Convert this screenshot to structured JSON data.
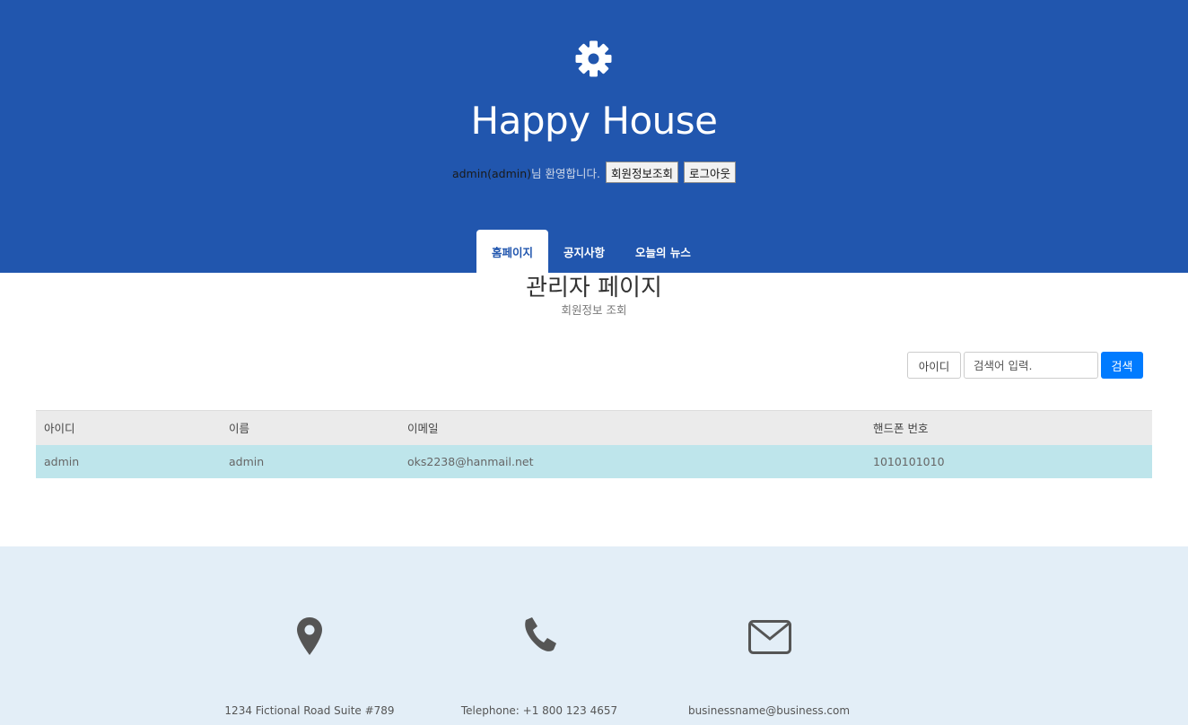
{
  "header": {
    "site_title": "Happy House",
    "welcome_user": "admin(admin)",
    "welcome_suffix": "님 환영합니다.",
    "member_info_button": "회원정보조회",
    "logout_button": "로그아웃",
    "icon": "gear-icon"
  },
  "nav": {
    "tabs": [
      {
        "label": "홈페이지",
        "active": true
      },
      {
        "label": "공지사항",
        "active": false
      },
      {
        "label": "오늘의 뉴스",
        "active": false
      }
    ]
  },
  "main": {
    "title": "관리자 페이지",
    "subtitle": "회원정보 조회",
    "search": {
      "type_label": "아이디",
      "placeholder": "검색어 입력.",
      "button": "검색"
    },
    "table": {
      "columns": [
        "아이디",
        "이름",
        "이메일",
        "핸드폰 번호"
      ],
      "rows": [
        [
          "admin",
          "admin",
          "oks2238@hanmail.net",
          "1010101010"
        ]
      ]
    }
  },
  "footer": {
    "address": "1234 Fictional Road Suite #789",
    "telephone": "Telephone: +1 800 123 4657",
    "email": "businessname@business.com",
    "icons": [
      "map-pin-icon",
      "phone-icon",
      "envelope-icon"
    ]
  },
  "colors": {
    "header_bg": "#2156ae",
    "footer_bg": "#e3eef7",
    "primary_button": "#007bff",
    "row_highlight": "#bee5eb"
  }
}
